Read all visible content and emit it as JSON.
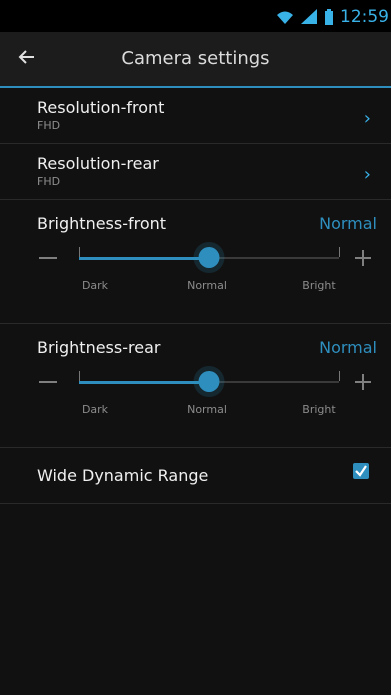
{
  "statusbar": {
    "time": "12:59",
    "icons": [
      "wifi-icon",
      "signal-icon",
      "battery-icon"
    ]
  },
  "appbar": {
    "title": "Camera settings",
    "back_icon": "arrow-left-icon"
  },
  "settings": {
    "resolution_front": {
      "label": "Resolution-front",
      "value": "FHD"
    },
    "resolution_rear": {
      "label": "Resolution-rear",
      "value": "FHD"
    },
    "brightness_front": {
      "label": "Brightness-front",
      "value": "Normal",
      "scale": {
        "min_label": "Dark",
        "mid_label": "Normal",
        "max_label": "Bright",
        "level": 0.5
      }
    },
    "brightness_rear": {
      "label": "Brightness-rear",
      "value": "Normal",
      "scale": {
        "min_label": "Dark",
        "mid_label": "Normal",
        "max_label": "Bright",
        "level": 0.5
      }
    },
    "wide_dynamic_range": {
      "label": "Wide Dynamic Range",
      "checked": true
    }
  },
  "colors": {
    "accent": "#2e8fbf",
    "accent_light": "#39b2e8",
    "background": "#111111",
    "appbar": "#1c1c1d"
  }
}
